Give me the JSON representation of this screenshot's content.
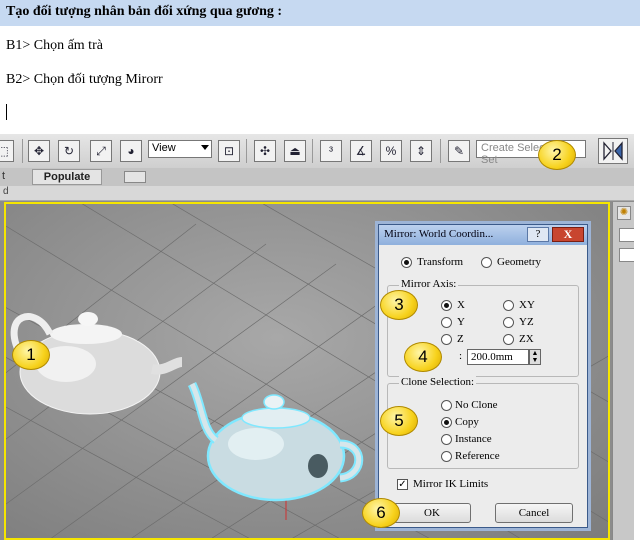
{
  "document": {
    "heading": "Tạo đối tượng nhân bản đối xứng qua gương :",
    "step1": "B1> Chọn ấm trà",
    "step2": "B2> Chọn đối tượng  Mirorr",
    "heading_bg": "#c6d9f1"
  },
  "toolbar": {
    "view_select": "View",
    "create_selection": "Create Selection Set"
  },
  "ribbon": {
    "left_text": "t",
    "tab": "Populate",
    "strip_text": "d"
  },
  "dialog": {
    "title": "Mirror: World Coordin...",
    "help": "?",
    "close": "X",
    "mode_transform": "Transform",
    "mode_geometry": "Geometry",
    "mirror_axis_title": "Mirror Axis:",
    "axes": [
      "X",
      "Y",
      "Z",
      "XY",
      "YZ",
      "ZX"
    ],
    "offset_label": ":",
    "offset_value": "200.0mm",
    "clone_title": "Clone Selection:",
    "clone_options": [
      "No Clone",
      "Copy",
      "Instance",
      "Reference"
    ],
    "mirror_ik": "Mirror IK Limits",
    "ok": "OK",
    "cancel": "Cancel"
  },
  "callouts": [
    "1",
    "2",
    "3",
    "4",
    "5",
    "6"
  ],
  "colors": {
    "callout": "#f7d21c",
    "viewport_border": "#f5e500",
    "selection_outline": "#7fe8ff"
  }
}
